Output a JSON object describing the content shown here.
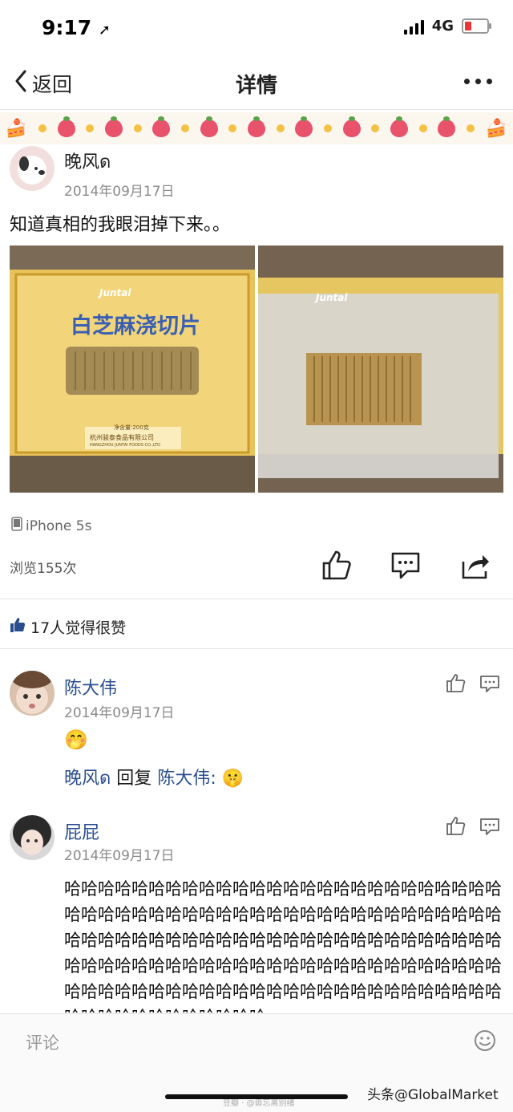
{
  "status": {
    "time": "9:17",
    "network": "4G"
  },
  "nav": {
    "back_label": "返回",
    "title": "详情"
  },
  "post": {
    "author": "晚风ด",
    "date": "2014年09月17日",
    "text": "知道真相的我眼泪掉下来。。",
    "photo1": {
      "brand": "Juntal",
      "product_name": "白芝麻浇切片",
      "maker": "杭州骏泰食品有限公司",
      "weight": "净含量:200克",
      "maker_en": "HANGZHOU JUNTAI FOODS CO.,LTD"
    },
    "photo2": {
      "brand": "Juntal"
    },
    "device": "iPhone 5s",
    "views": "浏览155次",
    "likes": "17人觉得很赞"
  },
  "comments": [
    {
      "author": "陈大伟",
      "date": "2014年09月17日",
      "emoji": "🤭",
      "reply_author": "晚风ด",
      "reply_word": "回复",
      "reply_target": "陈大伟:",
      "reply_emoji": "🤫"
    },
    {
      "author": "屁屁",
      "date": "2014年09月17日",
      "text": "哈哈哈哈哈哈哈哈哈哈哈哈哈哈哈哈哈哈哈哈哈哈哈哈哈哈哈哈哈哈哈哈哈哈哈哈哈哈哈哈哈哈哈哈哈哈哈哈哈哈哈哈哈哈哈哈哈哈哈哈哈哈哈哈哈哈哈哈哈哈哈哈哈哈哈哈哈哈哈哈哈哈哈哈哈哈哈哈哈哈哈哈哈哈哈哈哈哈哈哈哈哈哈哈哈哈哈哈哈哈哈哈哈哈哈哈哈哈哈哈哈哈哈哈哈哈哈哈哈哈哈哈哈哈哈哈哈哈哈哈哈哈"
    }
  ],
  "footer": {
    "comment_placeholder": "评论",
    "watermark": "头条@GlobalMarket",
    "watermark_small": "豆瓣 · @毋忘离别绪"
  },
  "colors": {
    "accent_blue": "#2a4d8f",
    "like_blue": "#2a4d8f"
  }
}
